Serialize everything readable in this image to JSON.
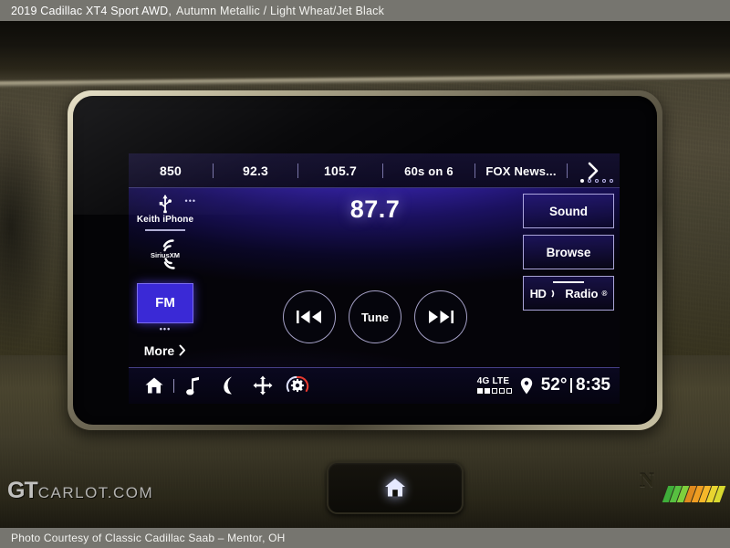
{
  "caption": {
    "top_vehicle": "2019 Cadillac XT4 Sport AWD,",
    "top_colors": "Autumn Metallic / Light Wheat/Jet Black",
    "bottom": "Photo Courtesy of Classic Cadillac Saab – Mentor, OH"
  },
  "watermark": {
    "brand_big": "GT",
    "brand_small": "CARLOT.COM",
    "slash_colors": [
      "#3fae3a",
      "#57c040",
      "#7fcf3d",
      "#e08a1e",
      "#ef9d22",
      "#f5b72a",
      "#e8d430",
      "#d8d92f"
    ]
  },
  "infotainment": {
    "presets": [
      {
        "label": "850"
      },
      {
        "label": "92.3"
      },
      {
        "label": "105.7"
      },
      {
        "label": "60s on 6"
      },
      {
        "label": "FOX News..."
      }
    ],
    "preset_next_icon": "chevron-right-icon",
    "page_dots": {
      "count": 5,
      "active_index": 0
    },
    "sources": {
      "usb": {
        "icon": "usb-icon",
        "label": "Keith iPhone"
      },
      "siriusxm": {
        "icon": "siriusxm-icon",
        "label": "SiriusXM"
      },
      "fm": {
        "label": "FM",
        "selected": true,
        "accent": "#3a29d6"
      },
      "more": {
        "label": "More",
        "icon": "chevron-right-icon"
      }
    },
    "now_playing": {
      "frequency": "87.7"
    },
    "transport": [
      {
        "name": "previous-track-button",
        "icon": "skip-back-icon",
        "label": ""
      },
      {
        "name": "tune-button",
        "icon": "",
        "label": "Tune"
      },
      {
        "name": "next-track-button",
        "icon": "skip-forward-icon",
        "label": ""
      }
    ],
    "right_buttons": [
      {
        "name": "sound-button",
        "label": "Sound"
      },
      {
        "name": "browse-button",
        "label": "Browse"
      },
      {
        "name": "hd-radio-button",
        "label": "Radio",
        "prefix": "HD"
      }
    ],
    "status_bar": {
      "icons": [
        {
          "name": "home-icon"
        },
        {
          "name": "audio-note-icon"
        },
        {
          "name": "phone-icon"
        },
        {
          "name": "navigation-icon"
        },
        {
          "name": "vehicle-settings-icon"
        }
      ],
      "network_label": "4G LTE",
      "signal_bars": {
        "total": 5,
        "filled": 2
      },
      "location_icon": "location-pin-icon",
      "temperature": "52°",
      "clock": "8:35"
    }
  },
  "console": {
    "home_button": {
      "icon": "home-icon"
    },
    "nfc_badge": {
      "icon": "nfc-icon",
      "glyph": "N"
    }
  }
}
